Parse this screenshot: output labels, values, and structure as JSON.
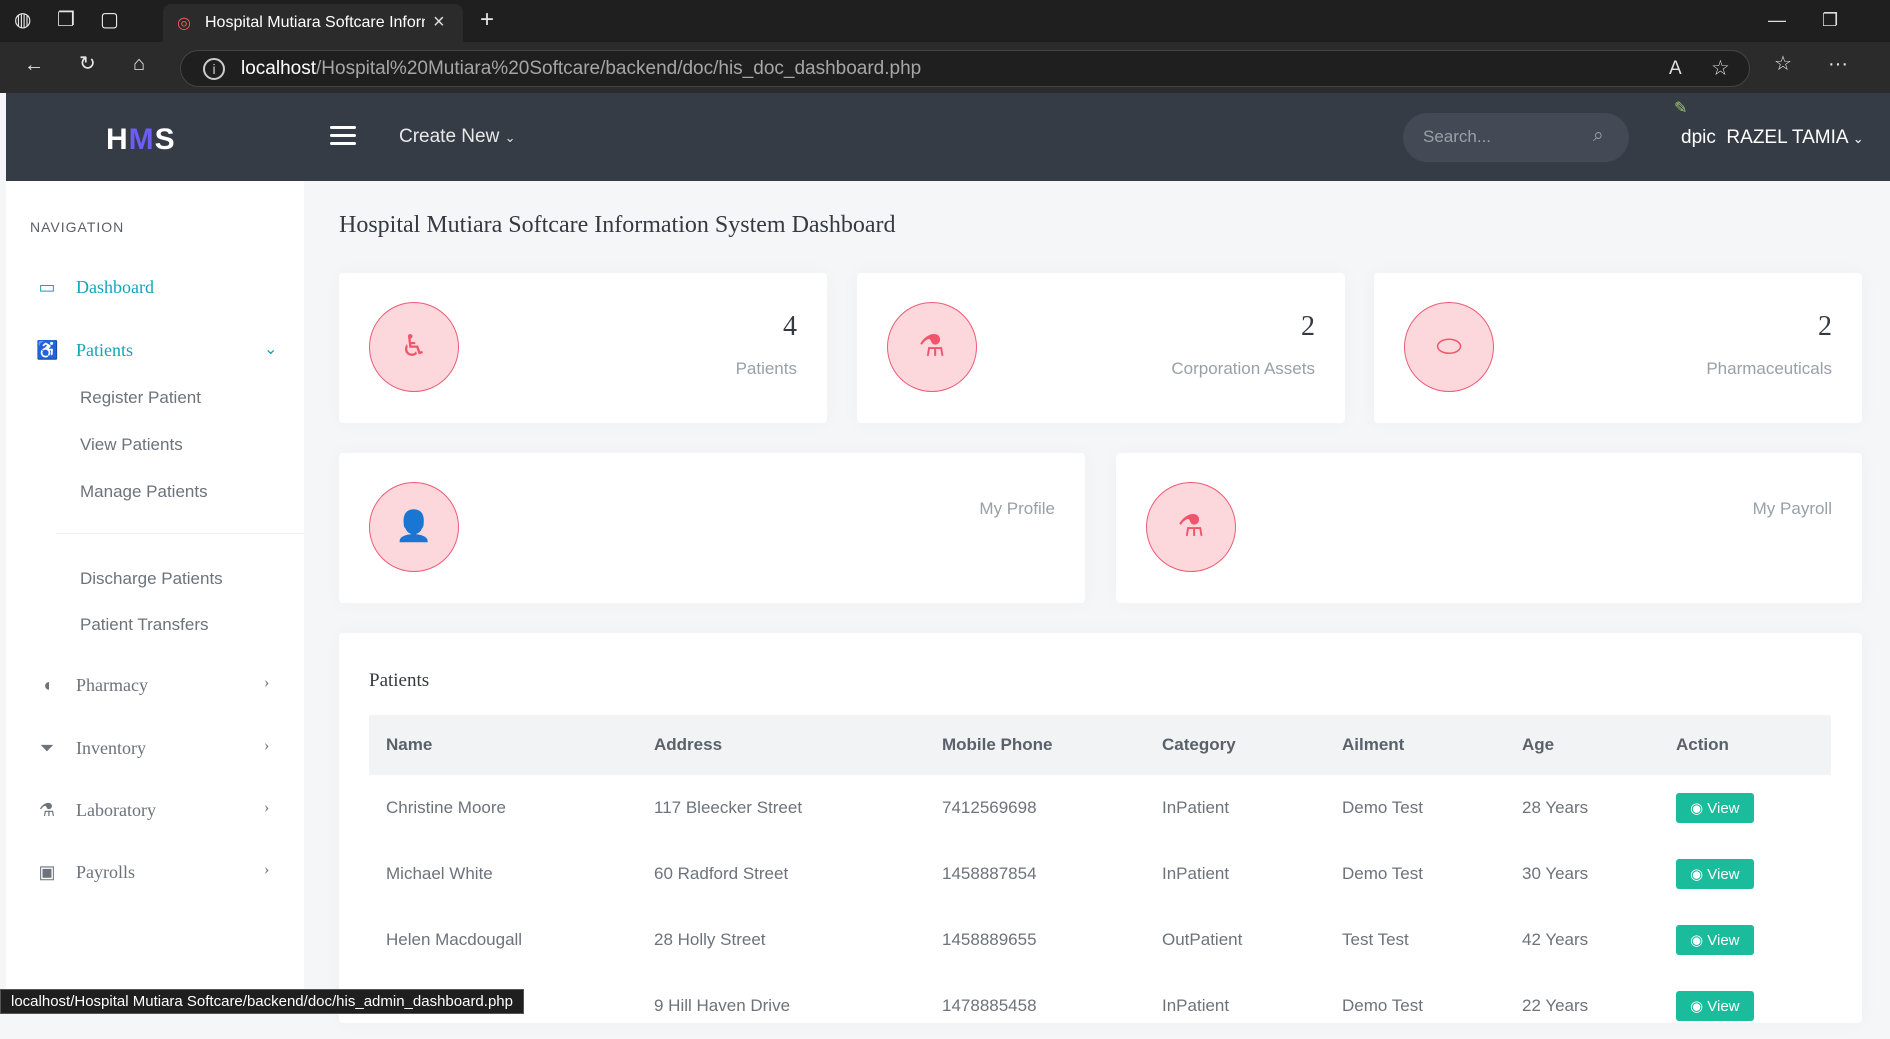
{
  "browser": {
    "tab_title": "Hospital Mutiara Softcare Information System",
    "url_host": "localhost",
    "url_path": "/Hospital%20Mutiara%20Softcare/backend/doc/his_doc_dashboard.php",
    "status_url": "localhost/Hospital Mutiara Softcare/backend/doc/his_admin_dashboard.php"
  },
  "header": {
    "logo_pre": "H",
    "logo_mid": "M",
    "logo_post": "S",
    "create_new": "Create New",
    "search_placeholder": "Search...",
    "user_avatar_alt": "dpic",
    "user_name": "RAZEL TAMIA"
  },
  "sidebar": {
    "heading": "NAVIGATION",
    "dashboard": "Dashboard",
    "patients": "Patients",
    "patients_sub": [
      "Register Patient",
      "View Patients",
      "Manage Patients",
      "Discharge Patients",
      "Patient Transfers"
    ],
    "pharmacy": "Pharmacy",
    "inventory": "Inventory",
    "laboratory": "Laboratory",
    "payrolls": "Payrolls"
  },
  "main": {
    "title": "Hospital Mutiara Softcare Information System Dashboard",
    "stats": [
      {
        "value": "4",
        "label": "Patients"
      },
      {
        "value": "2",
        "label": "Corporation Assets"
      },
      {
        "value": "2",
        "label": "Pharmaceuticals"
      }
    ],
    "profile_label": "My Profile",
    "payroll_label": "My Payroll",
    "table": {
      "title": "Patients",
      "headers": [
        "Name",
        "Address",
        "Mobile Phone",
        "Category",
        "Ailment",
        "Age",
        "Action"
      ],
      "rows": [
        [
          "Christine Moore",
          "117 Bleecker Street",
          "7412569698",
          "InPatient",
          "Demo Test",
          "28 Years"
        ],
        [
          "Michael White",
          "60 Radford Street",
          "1458887854",
          "InPatient",
          "Demo Test",
          "30 Years"
        ],
        [
          "Helen Macdougall",
          "28 Holly Street",
          "1458889655",
          "OutPatient",
          "Test Test",
          "42 Years"
        ],
        [
          "",
          "9 Hill Haven Drive",
          "1478885458",
          "InPatient",
          "Demo Test",
          "22 Years"
        ]
      ],
      "view_label": "View"
    }
  }
}
